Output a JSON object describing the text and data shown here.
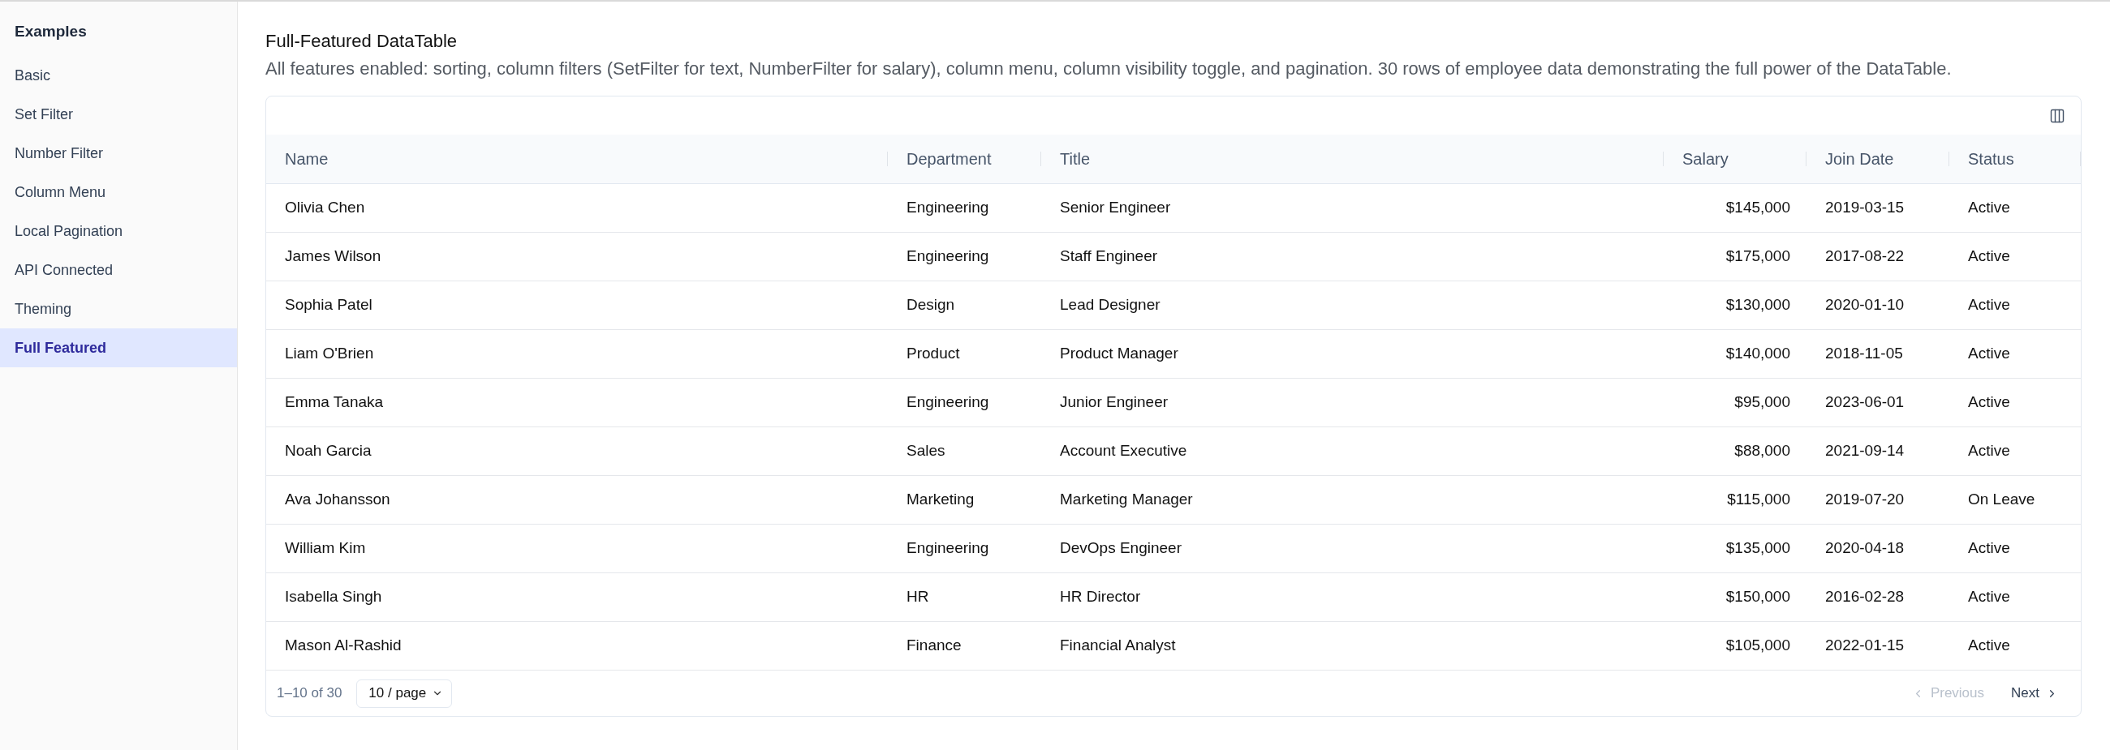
{
  "sidebar": {
    "title": "Examples",
    "items": [
      {
        "label": "Basic",
        "selected": false
      },
      {
        "label": "Set Filter",
        "selected": false
      },
      {
        "label": "Number Filter",
        "selected": false
      },
      {
        "label": "Column Menu",
        "selected": false
      },
      {
        "label": "Local Pagination",
        "selected": false
      },
      {
        "label": "API Connected",
        "selected": false
      },
      {
        "label": "Theming",
        "selected": false
      },
      {
        "label": "Full Featured",
        "selected": true
      }
    ]
  },
  "page": {
    "title": "Full-Featured DataTable",
    "description": "All features enabled: sorting, column filters (SetFilter for text, NumberFilter for salary), column menu, column visibility toggle, and pagination. 30 rows of employee data demonstrating the full power of the DataTable."
  },
  "table": {
    "columns": [
      {
        "label": "Name",
        "kind": "text"
      },
      {
        "label": "Department",
        "kind": "text"
      },
      {
        "label": "Title",
        "kind": "text"
      },
      {
        "label": "Salary",
        "kind": "number"
      },
      {
        "label": "Join Date",
        "kind": "text"
      },
      {
        "label": "Status",
        "kind": "text"
      }
    ],
    "rows": [
      [
        "Olivia Chen",
        "Engineering",
        "Senior Engineer",
        "$145,000",
        "2019-03-15",
        "Active"
      ],
      [
        "James Wilson",
        "Engineering",
        "Staff Engineer",
        "$175,000",
        "2017-08-22",
        "Active"
      ],
      [
        "Sophia Patel",
        "Design",
        "Lead Designer",
        "$130,000",
        "2020-01-10",
        "Active"
      ],
      [
        "Liam O'Brien",
        "Product",
        "Product Manager",
        "$140,000",
        "2018-11-05",
        "Active"
      ],
      [
        "Emma Tanaka",
        "Engineering",
        "Junior Engineer",
        "$95,000",
        "2023-06-01",
        "Active"
      ],
      [
        "Noah Garcia",
        "Sales",
        "Account Executive",
        "$88,000",
        "2021-09-14",
        "Active"
      ],
      [
        "Ava Johansson",
        "Marketing",
        "Marketing Manager",
        "$115,000",
        "2019-07-20",
        "On Leave"
      ],
      [
        "William Kim",
        "Engineering",
        "DevOps Engineer",
        "$135,000",
        "2020-04-18",
        "Active"
      ],
      [
        "Isabella Singh",
        "HR",
        "HR Director",
        "$150,000",
        "2016-02-28",
        "Active"
      ],
      [
        "Mason Al-Rashid",
        "Finance",
        "Financial Analyst",
        "$105,000",
        "2022-01-15",
        "Active"
      ]
    ]
  },
  "pagination": {
    "range": "1–10 of 30",
    "page_size": "10 / page",
    "previous": {
      "label": "Previous",
      "disabled": true
    },
    "next": {
      "label": "Next",
      "disabled": false
    }
  }
}
